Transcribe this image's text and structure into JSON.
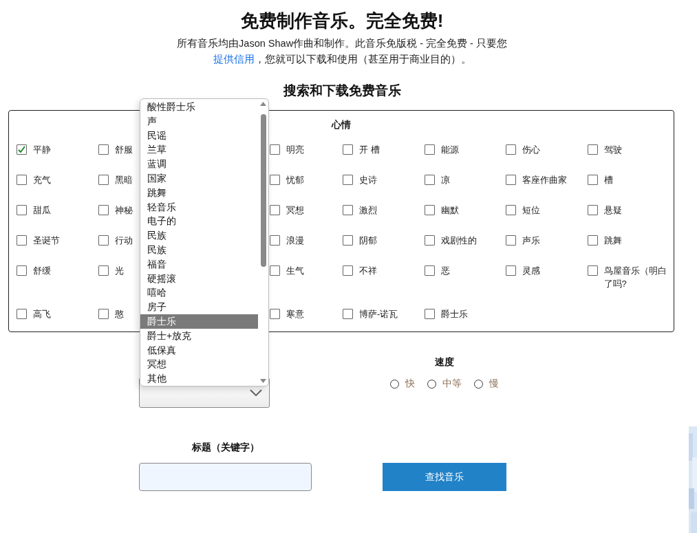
{
  "header": {
    "title": "免费制作音乐。完全免费!",
    "intro": "所有音乐均由Jason Shaw作曲和制作。此音乐免版税 - 完全免费 - 只要您",
    "intro_link": "提供信用",
    "intro_end": "，您就可以下载和使用（甚至用于商业目的）。"
  },
  "search_title": "搜索和下载免费音乐",
  "mood": {
    "title": "心情",
    "rows": [
      {
        "cells": [
          {
            "label": "平静",
            "checked": true
          },
          {
            "label": "舒服",
            "checked": false
          },
          {
            "label": "明亮",
            "checked": false
          },
          {
            "label": "开 槽",
            "checked": false
          },
          {
            "label": "能源",
            "checked": false
          },
          {
            "label": "伤心",
            "checked": false
          },
          {
            "label": "驾驶",
            "checked": false
          }
        ]
      },
      {
        "cells": [
          {
            "label": "充气",
            "checked": false
          },
          {
            "label": "黑暗",
            "checked": false
          },
          {
            "label": "忧郁",
            "checked": false
          },
          {
            "label": "史诗",
            "checked": false
          },
          {
            "label": "凉",
            "checked": false
          },
          {
            "label": "客座作曲家",
            "checked": false
          },
          {
            "label": "槽",
            "checked": false
          }
        ]
      },
      {
        "cells": [
          {
            "label": "甜瓜",
            "checked": false
          },
          {
            "label": "神秘",
            "checked": false
          },
          {
            "label": "冥想",
            "checked": false
          },
          {
            "label": "激烈",
            "checked": false
          },
          {
            "label": "幽默",
            "checked": false
          },
          {
            "label": "短位",
            "checked": false
          },
          {
            "label": "悬疑",
            "checked": false
          }
        ]
      },
      {
        "cells": [
          {
            "label": "圣诞节",
            "checked": false
          },
          {
            "label": "行动",
            "checked": false
          },
          {
            "label": "浪漫",
            "checked": false
          },
          {
            "label": "阴郁",
            "checked": false
          },
          {
            "label": "戏剧性的",
            "checked": false
          },
          {
            "label": "声乐",
            "checked": false
          },
          {
            "label": "跳舞",
            "checked": false
          }
        ]
      },
      {
        "cells": [
          {
            "label": "舒缓",
            "checked": false
          },
          {
            "label": "光",
            "checked": false
          },
          {
            "label": "生气",
            "checked": false
          },
          {
            "label": "不祥",
            "checked": false
          },
          {
            "label": "恶",
            "checked": false
          },
          {
            "label": "灵感",
            "checked": false
          },
          {
            "label": "鸟屋音乐（明白了吗?",
            "checked": false
          }
        ]
      },
      {
        "cells": [
          {
            "label": "高飞",
            "checked": false
          },
          {
            "label": "憨",
            "checked": false
          },
          {
            "label": "寒意",
            "checked": false
          },
          {
            "label": "博萨-诺瓦",
            "checked": false
          },
          {
            "label": "爵士乐",
            "checked": false
          }
        ]
      }
    ]
  },
  "genre": {
    "open": true,
    "options": [
      {
        "label": "酸性爵士乐",
        "selected": false
      },
      {
        "label": "声",
        "selected": false
      },
      {
        "label": "民谣",
        "selected": false
      },
      {
        "label": "兰草",
        "selected": false
      },
      {
        "label": "蓝调",
        "selected": false
      },
      {
        "label": "国家",
        "selected": false
      },
      {
        "label": "跳舞",
        "selected": false
      },
      {
        "label": "轻音乐",
        "selected": false
      },
      {
        "label": "电子的",
        "selected": false
      },
      {
        "label": "民族",
        "selected": false
      },
      {
        "label": "民族",
        "selected": false
      },
      {
        "label": "福音",
        "selected": false
      },
      {
        "label": "硬摇滚",
        "selected": false
      },
      {
        "label": "嘻哈",
        "selected": false
      },
      {
        "label": "房子",
        "selected": false
      },
      {
        "label": "爵士乐",
        "selected": true
      },
      {
        "label": "爵士+放克",
        "selected": false
      },
      {
        "label": "低保真",
        "selected": false
      },
      {
        "label": "冥想",
        "selected": false
      },
      {
        "label": "其他",
        "selected": false
      }
    ]
  },
  "speed": {
    "label": "速度",
    "options": [
      {
        "label": "快",
        "selected": false
      },
      {
        "label": "中等",
        "selected": false
      },
      {
        "label": "慢",
        "selected": false
      }
    ]
  },
  "keywords": {
    "label": "标题（关键字）"
  },
  "search_button": "查找音乐"
}
